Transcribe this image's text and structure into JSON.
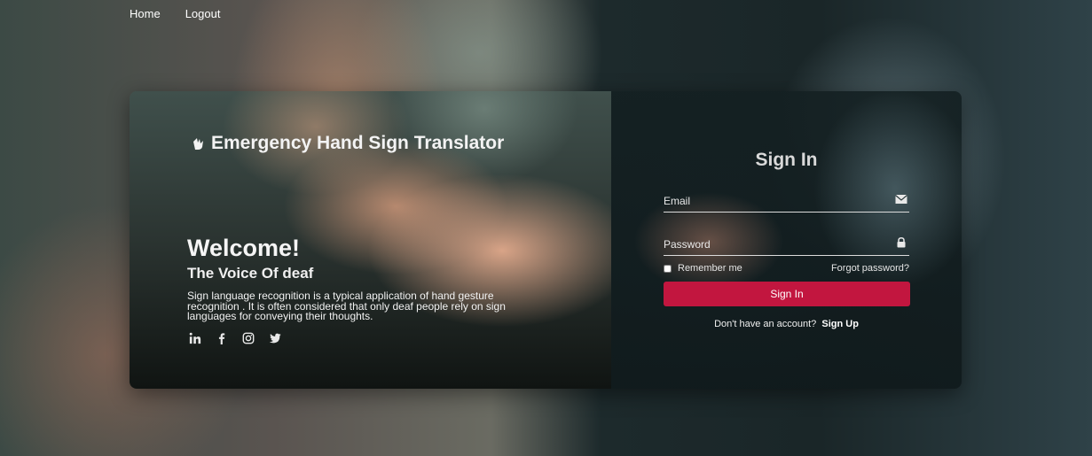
{
  "nav": {
    "items": [
      {
        "label": "Home"
      },
      {
        "label": "Logout"
      }
    ]
  },
  "hero": {
    "brand": "Emergency Hand Sign Translator",
    "welcome": "Welcome!",
    "tagline": "The Voice Of deaf",
    "description": "Sign language recognition is a typical application of hand gesture recognition . It is often considered that only deaf people rely on sign languages for conveying their thoughts.",
    "social_icons": [
      "linkedin-icon",
      "facebook-icon",
      "instagram-icon",
      "twitter-icon"
    ]
  },
  "signin": {
    "title": "Sign In",
    "email_placeholder": "Email",
    "password_placeholder": "Password",
    "remember_label": "Remember me",
    "forgot_label": "Forgot password?",
    "button_label": "Sign In",
    "no_account_text": "Don't have an account?",
    "signup_label": "Sign Up"
  },
  "colors": {
    "accent": "#c2163f",
    "text": "#ffffff"
  }
}
